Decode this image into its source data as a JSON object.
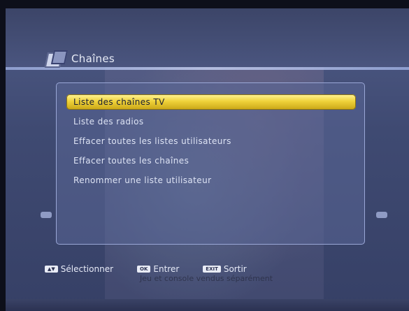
{
  "header": {
    "title": "Chaînes",
    "icon": "channels-icon"
  },
  "menu": {
    "items": [
      {
        "label": "Liste des chaînes TV",
        "selected": true
      },
      {
        "label": "Liste des radios",
        "selected": false
      },
      {
        "label": "Effacer toutes les listes utilisateurs",
        "selected": false
      },
      {
        "label": "Effacer toutes les chaînes",
        "selected": false
      },
      {
        "label": "Renommer une liste utilisateur",
        "selected": false
      }
    ],
    "highlight_color": "#efd23a"
  },
  "footer": {
    "select_key": "▲▼",
    "select_label": "Sélectionner",
    "ok_key": "OK",
    "ok_label": "Entrer",
    "exit_key": "EXIT",
    "exit_label": "Sortir",
    "background_caption": "Jeu et console vendus séparément"
  }
}
